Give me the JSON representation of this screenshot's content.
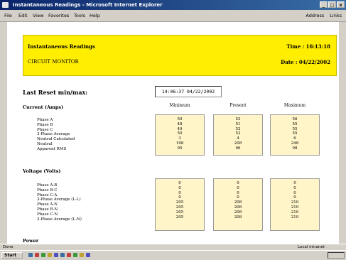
{
  "window": {
    "title": "Instantaneous Readings - Microsoft Internet Explorer",
    "buttons": [
      "_",
      "□",
      "x"
    ]
  },
  "menubar": {
    "items": [
      "File",
      "Edit",
      "View",
      "Favorites",
      "Tools",
      "Help"
    ],
    "right_items": [
      "Address",
      "Links"
    ]
  },
  "banner": {
    "title": "Instantaneous Readings",
    "subtitle": "CIRCUIT MONITOR",
    "time": "Time : 16:13:18",
    "date": "Date : 04/22/2002"
  },
  "last_reset": {
    "label": "Last Reset min/max:",
    "value": "14:06:37  04/22/2002"
  },
  "columns": [
    "Minimum",
    "Present",
    "Maximum"
  ],
  "current_section": {
    "title": "Current (Amps)",
    "rows": [
      {
        "label": "Phase A",
        "min": "50",
        "present": "53",
        "max": "56"
      },
      {
        "label": "Phase B",
        "min": "48",
        "present": "51",
        "max": "55"
      },
      {
        "label": "Phase C",
        "min": "49",
        "present": "52",
        "max": "55"
      },
      {
        "label": "3-Phase Average",
        "min": "50",
        "present": "52",
        "max": "55"
      },
      {
        "label": "Neutral Calculated",
        "min": "3",
        "present": "4",
        "max": "6"
      },
      {
        "label": "Neutral",
        "min": "198",
        "present": "208",
        "max": "248"
      },
      {
        "label": "Apparent RMS",
        "min": "95",
        "present": "96",
        "max": "98"
      }
    ]
  },
  "voltage_section": {
    "title": "Voltage (Volts)",
    "rows": [
      {
        "label": "Phase A-B",
        "min": "0",
        "present": "0",
        "max": "0"
      },
      {
        "label": "Phase B-C",
        "min": "0",
        "present": "0",
        "max": "0"
      },
      {
        "label": "Phase C-A",
        "min": "0",
        "present": "0",
        "max": "0"
      },
      {
        "label": "3-Phase Average (L-L)",
        "min": "0",
        "present": "0",
        "max": "0"
      },
      {
        "label": "Phase A-N",
        "min": "205",
        "present": "208",
        "max": "210"
      },
      {
        "label": "Phase B-N",
        "min": "205",
        "present": "208",
        "max": "210"
      },
      {
        "label": "Phase C-N",
        "min": "205",
        "present": "208",
        "max": "210"
      },
      {
        "label": "3-Phase Average (L-N)",
        "min": "205",
        "present": "208",
        "max": "210"
      }
    ]
  },
  "next_section_title": "Power",
  "status": {
    "left": "Done",
    "right": "Local intranet"
  },
  "taskbar": {
    "start_label": "Start"
  },
  "colors": {
    "banner": "#ffee00",
    "cell_bg": "#fff5c8",
    "titlebar": "#0a246a"
  }
}
